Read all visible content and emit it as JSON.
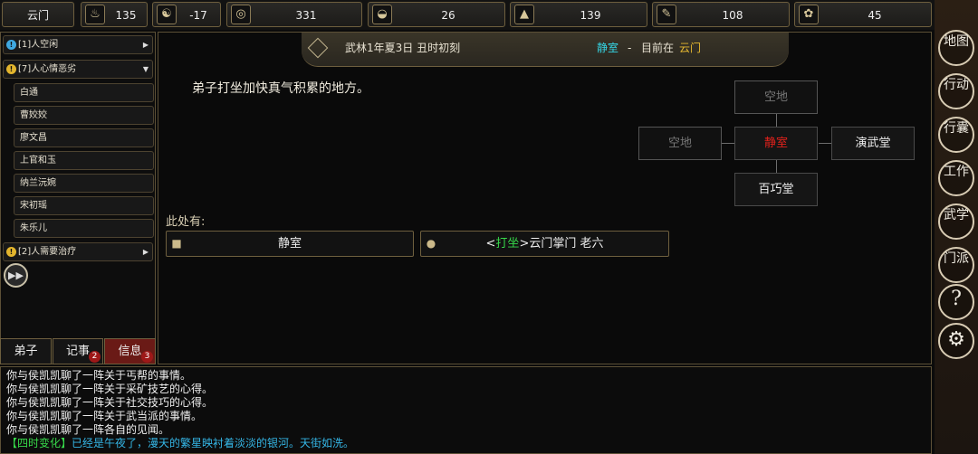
{
  "topbar": {
    "location": "云门",
    "stats": [
      {
        "icon": "drop-icon",
        "glyph": "♨",
        "value": "135"
      },
      {
        "icon": "yin-yang-icon",
        "glyph": "☯",
        "value": "-17"
      },
      {
        "icon": "coin-icon",
        "glyph": "◎",
        "value": "331"
      },
      {
        "icon": "food-bowl-icon",
        "glyph": "◒",
        "value": "26"
      },
      {
        "icon": "mountain-icon",
        "glyph": "▲",
        "value": "139"
      },
      {
        "icon": "scroll-icon",
        "glyph": "✎",
        "value": "108"
      },
      {
        "icon": "bag-icon",
        "glyph": "✿",
        "value": "45"
      }
    ]
  },
  "left_panel": {
    "groups": [
      {
        "label": "[1]人空闲",
        "badge": "!",
        "badge_color": "#3fa8e0",
        "arrow": "▶"
      },
      {
        "label": "[7]人心情恶劣",
        "badge": "!",
        "badge_color": "#e3b52d",
        "arrow": "▼"
      },
      {
        "label": "[2]人需要治疗",
        "badge": "!",
        "badge_color": "#e3b52d",
        "arrow": "▶"
      }
    ],
    "members": [
      "白通",
      "曹姣姣",
      "廖文昌",
      "上官和玉",
      "纳兰沅婉",
      "宋初瑶",
      "朱乐儿"
    ],
    "skip_label": "▶▶",
    "tabs": [
      {
        "label": "弟子",
        "count": ""
      },
      {
        "label": "记事",
        "count": "2"
      },
      {
        "label": "信息",
        "count": "3"
      }
    ]
  },
  "banner": {
    "date": "武林1年夏3日 丑时初刻",
    "room": "静室",
    "sep": "-",
    "location_prefix": "目前在",
    "location": "云门"
  },
  "description": "弟子打坐加快真气积累的地方。",
  "map": {
    "north": "空地",
    "west": "空地",
    "center": "静室",
    "east": "演武堂",
    "south": "百巧堂"
  },
  "here_label": "此处有:",
  "entities": [
    {
      "icon": "box-icon",
      "label": "静室"
    },
    {
      "icon": "person-icon",
      "action_open": "<",
      "action": "打坐",
      "action_close": ">",
      "label": "云门掌门 老六"
    }
  ],
  "log": {
    "lines": [
      "你与侯凯凯聊了一阵关于丐帮的事情。",
      "你与侯凯凯聊了一阵关于采矿技艺的心得。",
      "你与侯凯凯聊了一阵关于社交技巧的心得。",
      "你与侯凯凯聊了一阵关于武当派的事情。",
      "你与侯凯凯聊了一阵各自的见闻。"
    ],
    "season_tag": "【四时变化】",
    "season_text": "已经是午夜了，漫天的繁星映衬着淡淡的银河。天街如洗。"
  },
  "sidebar": [
    {
      "name": "map",
      "label": "地图"
    },
    {
      "name": "action",
      "label": "行动"
    },
    {
      "name": "bag",
      "label": "行囊"
    },
    {
      "name": "work",
      "label": "工作"
    },
    {
      "name": "martial",
      "label": "武学"
    },
    {
      "name": "sect",
      "label": "门派"
    },
    {
      "name": "help",
      "label": "?"
    },
    {
      "name": "settings",
      "label": "⚙"
    }
  ],
  "colors": {
    "accent": "#6e5f3e",
    "current_room": "#e0211b",
    "room_name": "#35d6e6",
    "location": "#e6b830",
    "action": "#37d94a",
    "season_tag": "#37d94a",
    "season_text": "#35b6e6"
  }
}
